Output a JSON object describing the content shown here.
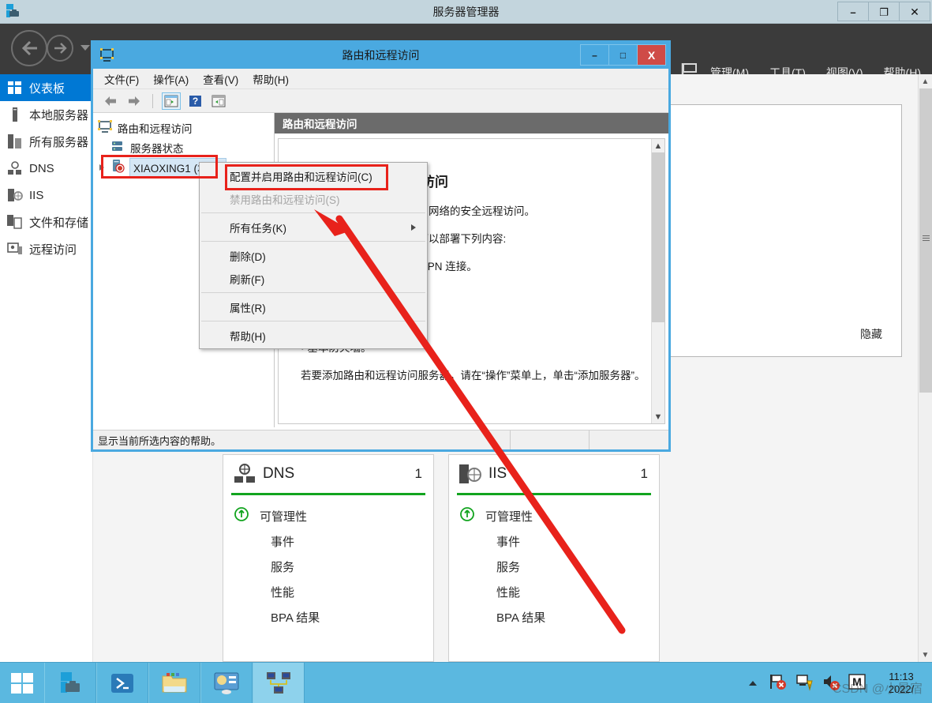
{
  "server_manager": {
    "title": "服务器管理器",
    "title_icon": "server-manager-icon",
    "window_buttons": {
      "minimize": "–",
      "maximize": "❐",
      "close": "✕"
    },
    "menu": [
      {
        "label": "管理(M)",
        "name": "manage-menu"
      },
      {
        "label": "工具(T)",
        "name": "tools-menu"
      },
      {
        "label": "视图(V)",
        "name": "view-menu"
      },
      {
        "label": "帮助(H)",
        "name": "help-menu"
      }
    ],
    "notification_icon": "flag-warning-icon",
    "sidebar": [
      {
        "label": "仪表板",
        "icon": "dashboard-icon",
        "active": true
      },
      {
        "label": "本地服务器",
        "icon": "local-server-icon",
        "active": false
      },
      {
        "label": "所有服务器",
        "icon": "all-servers-icon",
        "active": false
      },
      {
        "label": "DNS",
        "icon": "dns-icon",
        "active": false
      },
      {
        "label": "IIS",
        "icon": "iis-icon",
        "active": false
      },
      {
        "label": "文件和存储",
        "icon": "file-storage-icon",
        "active": false
      },
      {
        "label": "远程访问",
        "icon": "remote-access-icon",
        "active": false
      }
    ],
    "hide_link": "隐藏",
    "tiles": [
      {
        "name": "DNS",
        "count": "1",
        "icon": "dns-icon",
        "accent_color": "#12a41f",
        "rows": [
          {
            "label": "可管理性",
            "icon": "status-up-icon"
          },
          {
            "label": "事件",
            "icon": ""
          },
          {
            "label": "服务",
            "icon": ""
          },
          {
            "label": "性能",
            "icon": ""
          },
          {
            "label": "BPA 结果",
            "icon": ""
          }
        ]
      },
      {
        "name": "IIS",
        "count": "1",
        "icon": "iis-icon",
        "accent_color": "#12a41f",
        "rows": [
          {
            "label": "可管理性",
            "icon": "status-up-icon"
          },
          {
            "label": "事件",
            "icon": ""
          },
          {
            "label": "服务",
            "icon": ""
          },
          {
            "label": "性能",
            "icon": ""
          },
          {
            "label": "BPA 结果",
            "icon": ""
          }
        ]
      }
    ]
  },
  "mmc": {
    "title": "路由和远程访问",
    "title_icon": "rras-console-icon",
    "window_buttons": {
      "minimize": "–",
      "maximize": "□",
      "close": "X"
    },
    "menu": [
      {
        "label": "文件(F)",
        "name": "file-menu"
      },
      {
        "label": "操作(A)",
        "name": "action-menu"
      },
      {
        "label": "查看(V)",
        "name": "view-menu"
      },
      {
        "label": "帮助(H)",
        "name": "help-menu"
      }
    ],
    "toolbar": [
      {
        "icon": "back-arrow-icon",
        "name": "back-button"
      },
      {
        "icon": "forward-arrow-icon",
        "name": "forward-button"
      },
      {
        "icon": "show-console-tree-icon",
        "name": "show-console-tree-button",
        "selected": true
      },
      {
        "icon": "help-icon",
        "name": "help-button"
      },
      {
        "icon": "show-action-pane-icon",
        "name": "show-action-pane-button"
      }
    ],
    "tree": [
      {
        "label": "路由和远程访问",
        "icon": "rras-root-icon",
        "level": 1,
        "expandable": false,
        "selected": false
      },
      {
        "label": "服务器状态",
        "icon": "server-status-icon",
        "level": 2,
        "expandable": false,
        "selected": false
      },
      {
        "label": "XIAOXING1 (本地)",
        "icon": "server-node-icon",
        "level": 2,
        "expandable": true,
        "selected": true
      }
    ],
    "right_pane": {
      "header": "路由和远程访问",
      "heading": "欢迎使用路由和远程访问",
      "paragraphs": [
        "路由和远程访问提供对专用网络的安全远程访问。",
        "使用路由和远程访问，你可以部署下列内容:",
        "• VPN 网关、站点到站点 VPN 连接。",
        "• 基本防火墙。",
        "若要添加路由和远程访问服务器，请在“操作”菜单上，单击“添加服务器”。"
      ]
    },
    "status_bar": "显示当前所选内容的帮助。"
  },
  "context_menu": {
    "items": [
      {
        "label": "配置并启用路由和远程访问(C)",
        "disabled": false,
        "submenu": false,
        "separator_after": false
      },
      {
        "label": "禁用路由和远程访问(S)",
        "disabled": true,
        "submenu": false,
        "separator_after": true
      },
      {
        "label": "所有任务(K)",
        "disabled": false,
        "submenu": true,
        "separator_after": true
      },
      {
        "label": "删除(D)",
        "disabled": false,
        "submenu": false,
        "separator_after": false
      },
      {
        "label": "刷新(F)",
        "disabled": false,
        "submenu": false,
        "separator_after": true
      },
      {
        "label": "属性(R)",
        "disabled": false,
        "submenu": false,
        "separator_after": true
      },
      {
        "label": "帮助(H)",
        "disabled": false,
        "submenu": false,
        "separator_after": false
      }
    ]
  },
  "annotations": {
    "color": "#e8221b",
    "boxes": [
      {
        "name": "tree-node-highlight"
      },
      {
        "name": "menu-item-highlight"
      }
    ],
    "arrow": {
      "name": "pointer-arrow",
      "points_to": "所有任务(K)"
    }
  },
  "taskbar": {
    "start_icon": "windows-start-icon",
    "apps": [
      {
        "icon": "server-manager-icon",
        "name": "taskbar-server-manager",
        "active": false
      },
      {
        "icon": "powershell-icon",
        "name": "taskbar-powershell",
        "active": false
      },
      {
        "icon": "file-explorer-icon",
        "name": "taskbar-file-explorer",
        "active": false
      },
      {
        "icon": "control-panel-icon",
        "name": "taskbar-control-panel",
        "active": false
      },
      {
        "icon": "network-rras-icon",
        "name": "taskbar-rras",
        "active": true
      }
    ],
    "tray": [
      {
        "icon": "flag-error-icon",
        "name": "tray-action-center"
      },
      {
        "icon": "network-warning-icon",
        "name": "tray-network"
      },
      {
        "icon": "volume-muted-icon",
        "name": "tray-volume"
      },
      {
        "icon": "ime-icon",
        "name": "tray-ime",
        "label": "M"
      }
    ],
    "clock": {
      "time": "11:13",
      "date": "2022/"
    }
  },
  "watermark": "CSDN @小星宿"
}
